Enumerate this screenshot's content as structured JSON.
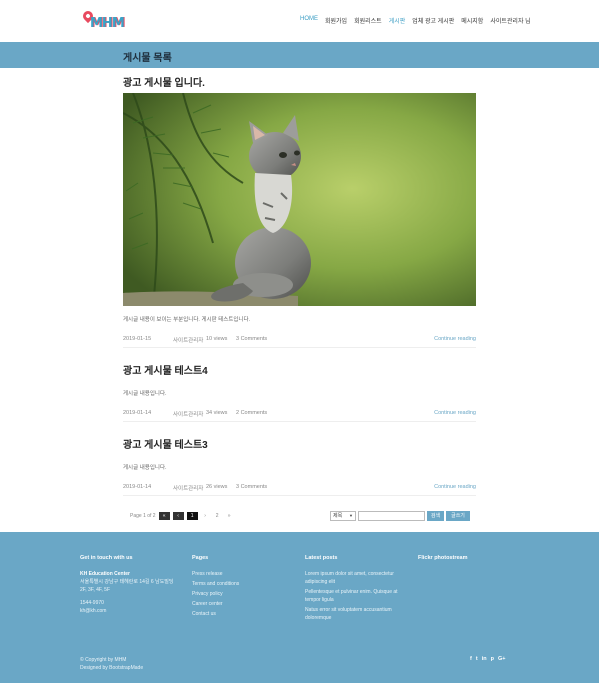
{
  "header": {
    "logo_text": "MHM",
    "nav": [
      {
        "label": "HOME",
        "active": true
      },
      {
        "label": "회원가입",
        "active": false
      },
      {
        "label": "회원리스트",
        "active": false
      },
      {
        "label": "게시판",
        "active": false
      },
      {
        "label": "업체 광고 게시판",
        "active": false
      },
      {
        "label": "메시지함",
        "active": false
      },
      {
        "label": "사이트관리자 님",
        "active": false
      }
    ]
  },
  "page_title": "게시물 목록",
  "posts": [
    {
      "title": "광고 게시물 입니다.",
      "has_image": true,
      "image_icon": "kitten-photo",
      "excerpt": "게시글 내용이 보이는 부분입니다. 게시판 테스트입니다.",
      "date": "2019-01-15",
      "author": "사이트관리자",
      "views": "10 views",
      "comments": "3 Comments",
      "more": "Continue reading"
    },
    {
      "title": "광고 게시물 테스트4",
      "has_image": false,
      "excerpt": "게시글 내용입니다.",
      "date": "2019-01-14",
      "author": "사이트관리자",
      "views": "34 views",
      "comments": "2 Comments",
      "more": "Continue reading"
    },
    {
      "title": "광고 게시물 테스트3",
      "has_image": false,
      "excerpt": "게시글 내용입니다.",
      "date": "2019-01-14",
      "author": "사이트관리자",
      "views": "26 views",
      "comments": "3 Comments",
      "more": "Continue reading"
    }
  ],
  "pager": {
    "label": "Page 1 of 2",
    "first": "«",
    "prev": "‹",
    "current": "1",
    "next": "›",
    "page2": "2",
    "last": "»"
  },
  "search": {
    "select_value": "제목",
    "placeholder": "",
    "search_button": "검색",
    "write_button": "글쓰기"
  },
  "footer": {
    "contact_title": "Get in touch with us",
    "org": "KH Education Center",
    "address": "서울특별시 강남구 테헤란로 14길 6 남도빌딩 2F, 3F, 4F, 5F",
    "phone": "1544-9970",
    "email": "kh@kh.com",
    "pages_title": "Pages",
    "pages": [
      "Press release",
      "Terms and conditions",
      "Privacy policy",
      "Career center",
      "Contact us"
    ],
    "latest_title": "Latest posts",
    "latest": [
      "Lorem ipsum dolor sit amet, consectetur adipiscing elit",
      "Pellentesque et pulvinar enim. Quisque at tempor ligula",
      "Natus error sit voluptatem accusantium doloremque"
    ],
    "flickr_title": "Flickr photostream",
    "copyright": "© Copyright by MHM",
    "designed": "Designed by BootstrapMade",
    "social": [
      "f",
      "t",
      "in",
      "p",
      "G+"
    ]
  },
  "colors": {
    "accent": "#6aa7c6",
    "title_dark": "#1e2d3b",
    "logo_red": "#e84a5f"
  }
}
